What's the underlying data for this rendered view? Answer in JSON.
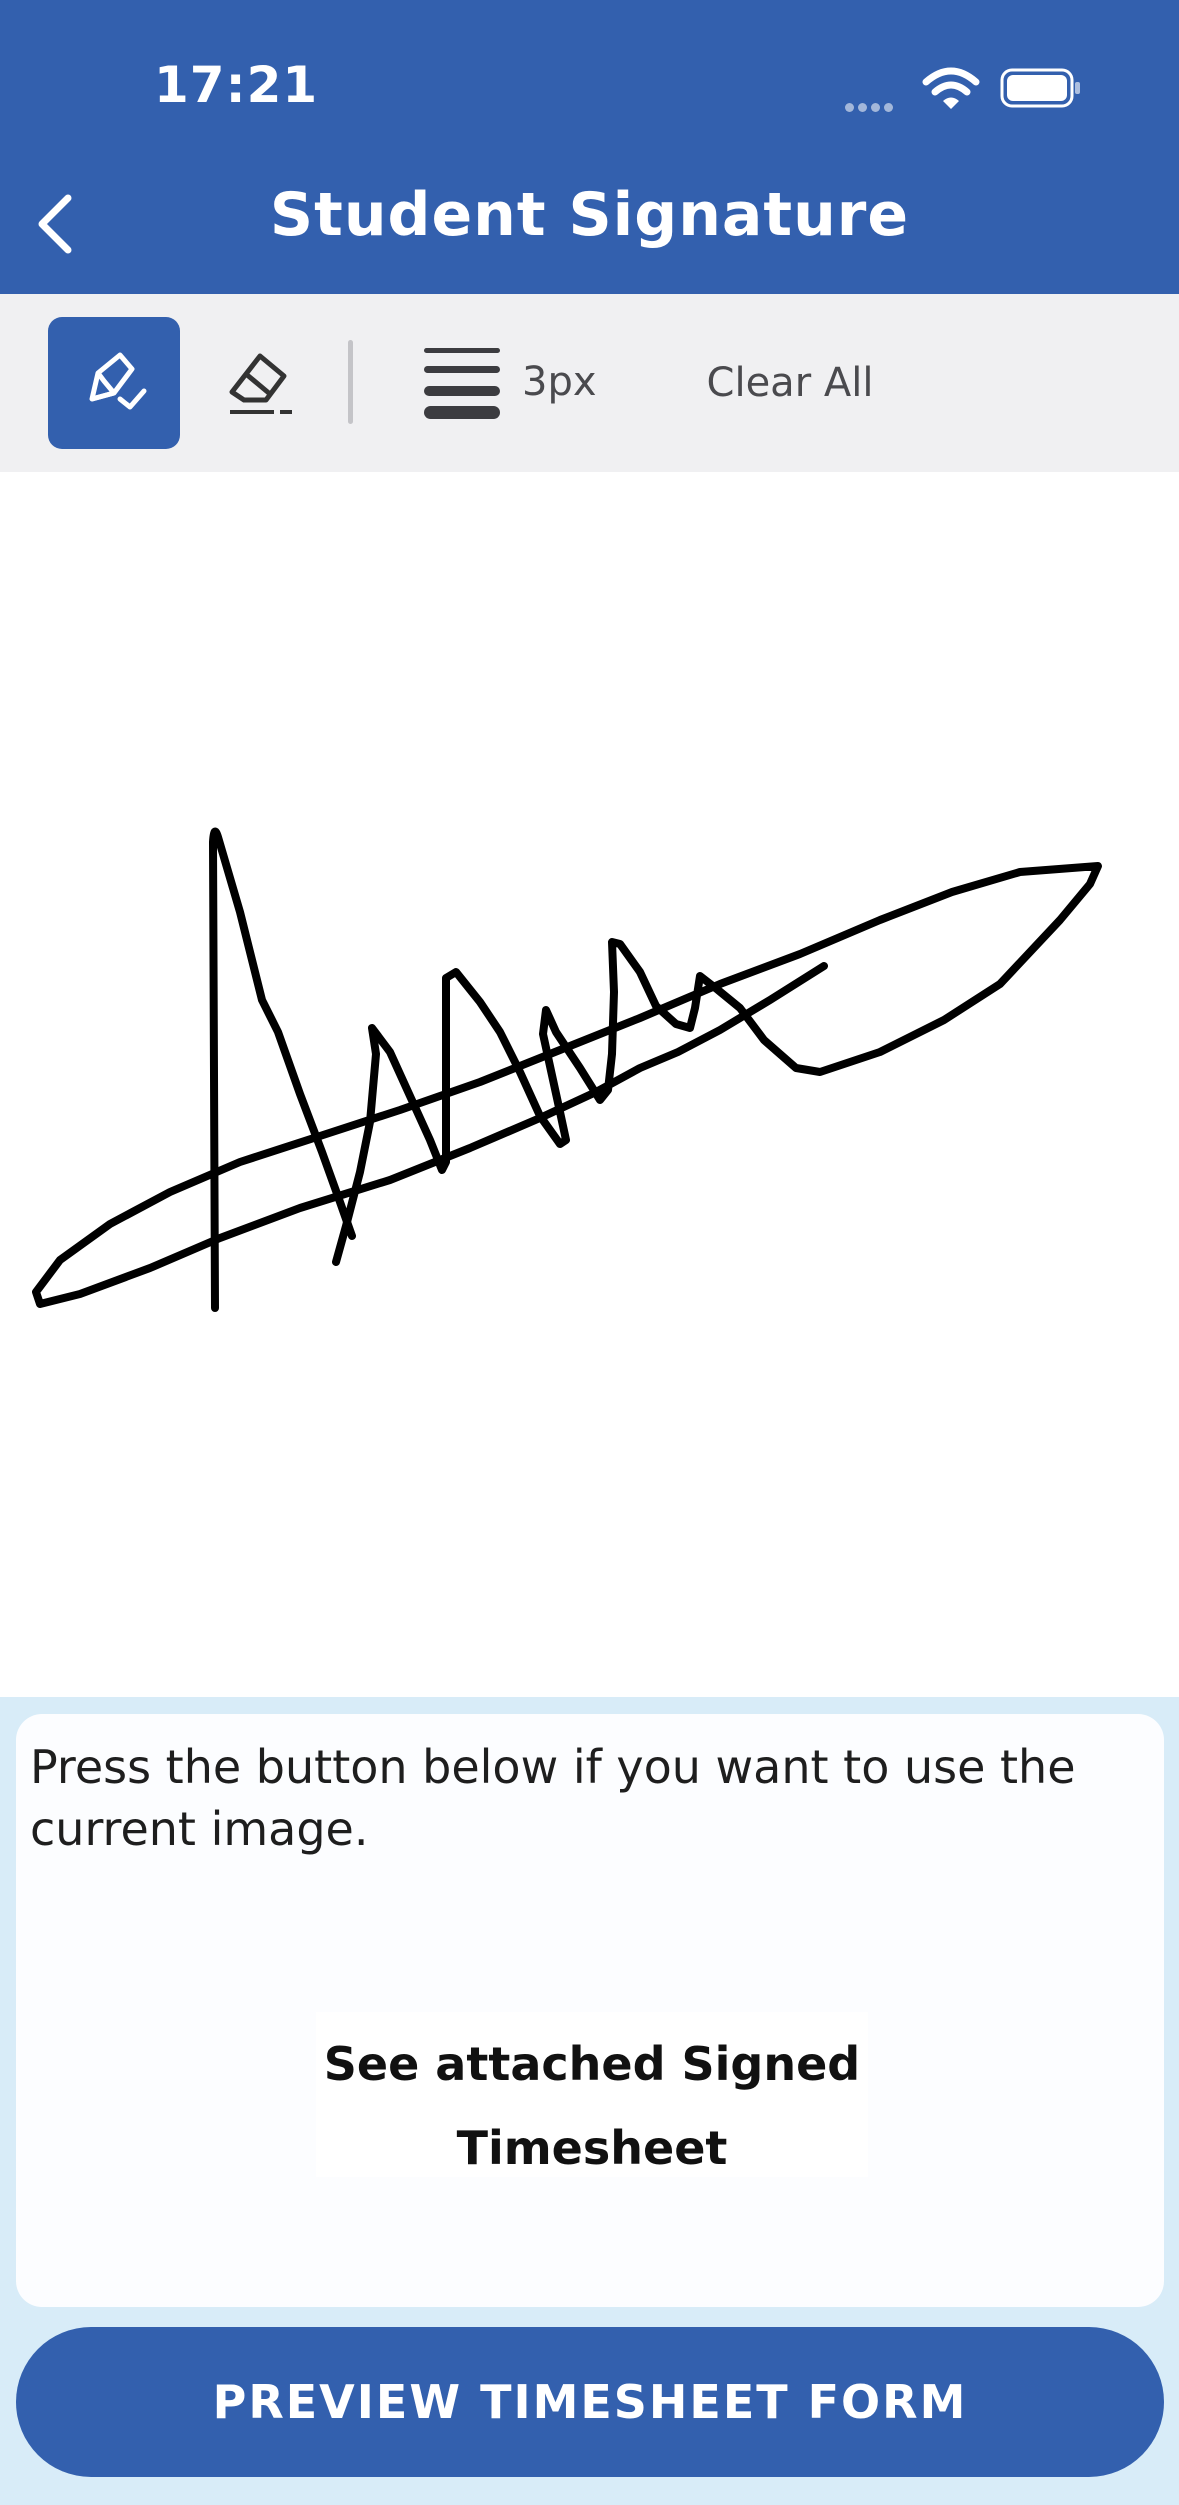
{
  "status_bar": {
    "time": "17:21"
  },
  "header": {
    "title": "Student Signature"
  },
  "toolbar": {
    "stroke_width": "3px",
    "clear_label": "Clear All"
  },
  "colors": {
    "brand": "#3360ae",
    "toolbar_bg": "#f0f0f2",
    "panel_bg": "#d8ecf8",
    "ink": "#000000"
  },
  "icons": {
    "back": "chevron-left-icon",
    "pen": "pen-icon",
    "eraser": "eraser-icon",
    "stroke": "stroke-width-icon",
    "wifi": "wifi-icon",
    "battery": "battery-icon"
  },
  "info": {
    "message": "Press the button below if you want to use the current image.",
    "attached_line1": "See attached Signed",
    "attached_line2": "Timesheet"
  },
  "actions": {
    "preview_label": "PREVIEW TIMESHEET FORM"
  }
}
